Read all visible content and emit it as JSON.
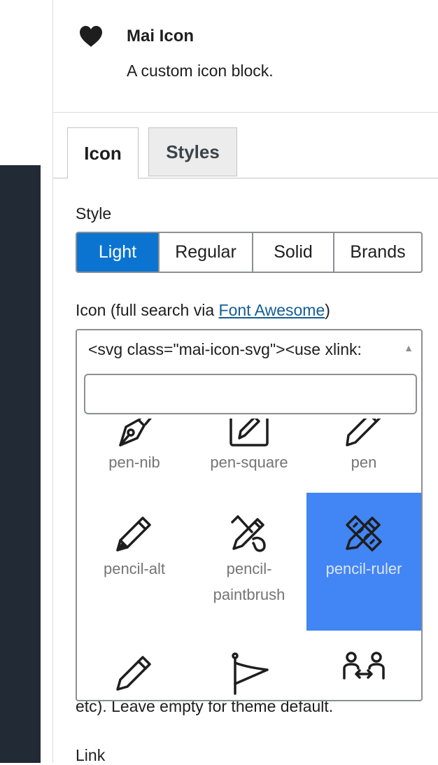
{
  "block": {
    "title": "Mai Icon",
    "description": "A custom icon block.",
    "icon": "heart-icon"
  },
  "tabs": [
    {
      "label": "Icon",
      "active": true
    },
    {
      "label": "Styles",
      "active": false
    }
  ],
  "style": {
    "label": "Style",
    "options": [
      "Light",
      "Regular",
      "Solid",
      "Brands"
    ],
    "selected": "Light",
    "accent_color": "#0b74d1"
  },
  "icon_field": {
    "label_prefix": "Icon (full search via ",
    "link_text": "Font Awesome",
    "label_suffix": ")",
    "selected_value": "<svg class=\"mai-icon-svg\"><use xlink:",
    "search_placeholder": ""
  },
  "icon_grid": {
    "selected": "pencil-ruler",
    "highlight_color": "#4285f4",
    "items": [
      {
        "name": "pen-nib",
        "label": "pen-nib",
        "icon": "pen-nib-icon"
      },
      {
        "name": "pen-square",
        "label": "pen-square",
        "icon": "pen-square-icon"
      },
      {
        "name": "pen",
        "label": "pen",
        "icon": "pen-icon"
      },
      {
        "name": "pencil-alt",
        "label": "pencil-alt",
        "icon": "pencil-icon"
      },
      {
        "name": "pencil-paintbrush",
        "label_line1": "pencil-",
        "label_line2": "paintbrush",
        "icon": "pencil-paintbrush-icon"
      },
      {
        "name": "pencil-ruler",
        "label": "pencil-ruler",
        "icon": "pencil-ruler-icon"
      },
      {
        "name": "pencil-partial",
        "icon": "pencil-icon"
      },
      {
        "name": "pennant",
        "icon": "pennant-icon"
      },
      {
        "name": "people-arrows",
        "icon": "people-arrows-icon"
      }
    ]
  },
  "help_text": "etc). Leave empty for theme default.",
  "link_label": "Link"
}
